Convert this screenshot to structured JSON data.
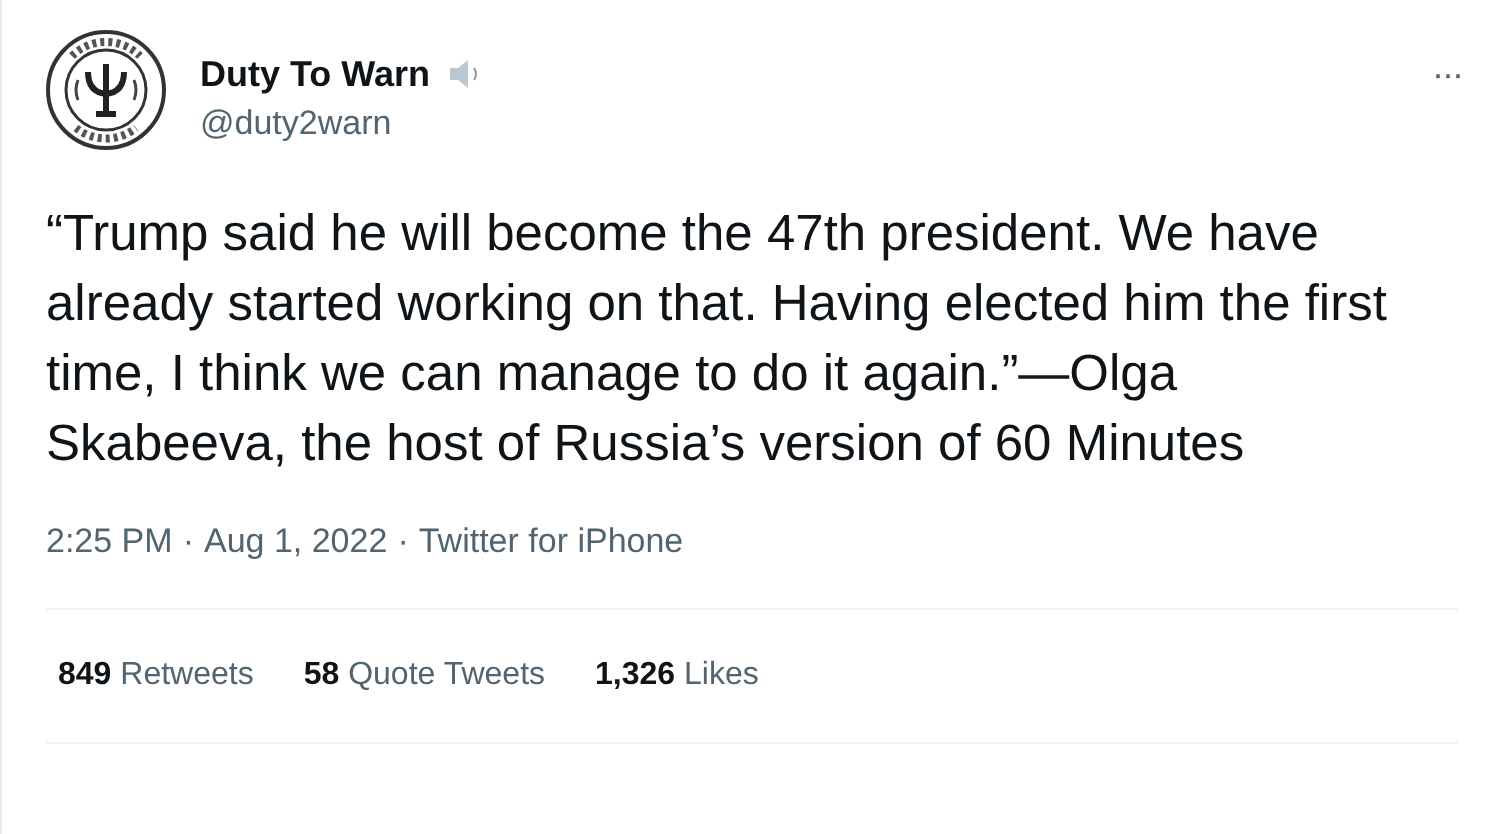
{
  "author": {
    "name": "Duty To Warn",
    "handle": "@duty2warn"
  },
  "more_button": "···",
  "text": "“Trump said he will become the 47th president. We have already started working on that. Having elected him the first time, I think we can manage to do it again.”—Olga Skabeeva, the host of Russia’s version of 60 Minutes",
  "meta": {
    "time": "2:25 PM",
    "date": "Aug 1, 2022",
    "source": "Twitter for iPhone",
    "separator": "·"
  },
  "stats": [
    "**849** Retweets",
    "**58** Quote Tweets",
    "**1,326** Likes"
  ]
}
